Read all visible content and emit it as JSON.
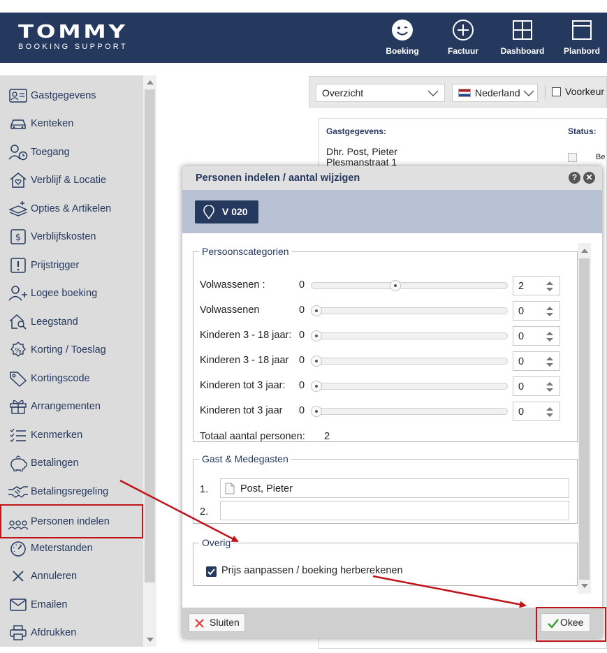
{
  "header": {
    "logo_main": "TOMMY",
    "logo_sub": "BOOKING SUPPORT",
    "nav": [
      {
        "label": "Boeking",
        "icon": "smiley-icon"
      },
      {
        "label": "Factuur",
        "icon": "plus-circle-icon"
      },
      {
        "label": "Dashboard",
        "icon": "dashboard-icon"
      },
      {
        "label": "Planbord",
        "icon": "planbord-icon"
      }
    ]
  },
  "sidebar": {
    "items": [
      {
        "label": "Gastgegevens",
        "icon": "guest-card-icon"
      },
      {
        "label": "Kenteken",
        "icon": "car-icon"
      },
      {
        "label": "Toegang",
        "icon": "person-clock-icon"
      },
      {
        "label": "Verblijf & Locatie",
        "icon": "house-heart-icon"
      },
      {
        "label": "Opties & Artikelen",
        "icon": "layers-plus-icon"
      },
      {
        "label": "Verblijfskosten",
        "icon": "dollar-icon"
      },
      {
        "label": "Prijstrigger",
        "icon": "exclamation-icon"
      },
      {
        "label": "Logee boeking",
        "icon": "person-plus-icon"
      },
      {
        "label": "Leegstand",
        "icon": "house-search-icon"
      },
      {
        "label": "Korting / Toeslag",
        "icon": "percent-badge-icon"
      },
      {
        "label": "Kortingscode",
        "icon": "tag-icon"
      },
      {
        "label": "Arrangementen",
        "icon": "gift-icon"
      },
      {
        "label": "Kenmerken",
        "icon": "checklist-icon"
      },
      {
        "label": "Betalingen",
        "icon": "piggy-bank-icon"
      },
      {
        "label": "Betalingsregeling",
        "icon": "handshake-icon"
      },
      {
        "label": "Personen indelen",
        "icon": "people-group-icon"
      },
      {
        "label": "Meterstanden",
        "icon": "gauge-icon"
      },
      {
        "label": "Annuleren",
        "icon": "x-icon"
      },
      {
        "label": "Emailen",
        "icon": "envelope-icon"
      },
      {
        "label": "Afdrukken",
        "icon": "printer-icon"
      }
    ],
    "active_label": "Personen indelen"
  },
  "main": {
    "view_select": "Overzicht",
    "language_select": "Nederlands",
    "checkbox_label": "Voorkeur",
    "card": {
      "guest_heading": "Gastgegevens:",
      "status_heading": "Status:",
      "guest_name": "Dhr. Post, Pieter",
      "guest_street": "Plesmanstraat 1",
      "status_text": "Be"
    }
  },
  "dialog": {
    "title": "Personen indelen / aantal wijzigen",
    "location": "V 020",
    "categories_legend": "Persoonscategorien",
    "categories": [
      {
        "label": "Volwassenen :",
        "min": "0",
        "value": "2",
        "fraction": 0.4
      },
      {
        "label": "Volwassenen",
        "min": "0",
        "value": "0",
        "fraction": 0
      },
      {
        "label": "Kinderen 3 - 18 jaar:",
        "min": "0",
        "value": "0",
        "fraction": 0
      },
      {
        "label": "Kinderen 3 - 18 jaar",
        "min": "0",
        "value": "0",
        "fraction": 0
      },
      {
        "label": "Kinderen tot 3 jaar:",
        "min": "0",
        "value": "0",
        "fraction": 0
      },
      {
        "label": "Kinderen tot 3 jaar",
        "min": "0",
        "value": "0",
        "fraction": 0
      }
    ],
    "total_label": "Totaal aantal personen:",
    "total_value": "2",
    "guests_legend": "Gast & Medegasten",
    "guests": [
      {
        "num": "1.",
        "name": "Post, Pieter"
      },
      {
        "num": "2.",
        "name": ""
      }
    ],
    "other_legend": "Overig",
    "recalc_label": "Prijs aanpassen / boeking herberekenen",
    "close_label": "Sluiten",
    "ok_label": "Okee"
  },
  "colors": {
    "header_bg": "#25395f",
    "sidebar_bg": "#dcdcdc",
    "annotation_red": "#c0141b",
    "ok_check_green": "#2e9b2e",
    "close_x_red": "#e03b3b"
  }
}
